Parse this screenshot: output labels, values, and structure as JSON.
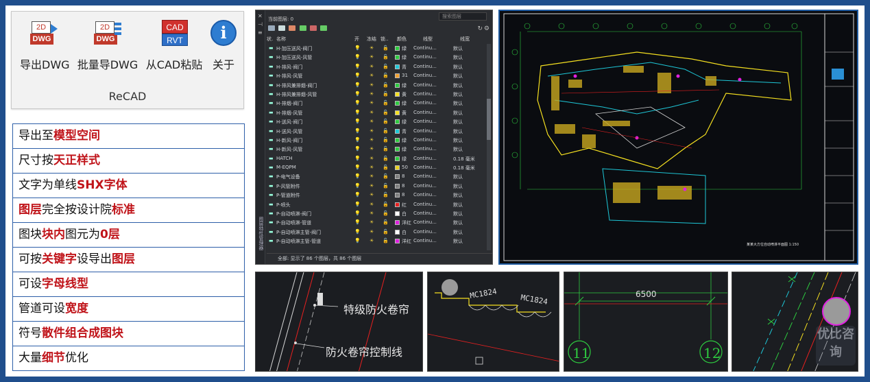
{
  "ribbon": {
    "buttons": [
      {
        "label": "导出DWG",
        "icon": "export-dwg-icon",
        "icon_text_top": "2D",
        "icon_text_bottom": "DWG"
      },
      {
        "label": "批量导DWG",
        "icon": "batch-export-dwg-icon",
        "icon_text_top": "2D",
        "icon_text_bottom": "DWG"
      },
      {
        "label": "从CAD粘贴",
        "icon": "paste-from-cad-icon",
        "icon_text_top": "CAD",
        "icon_text_bottom": "RVT"
      },
      {
        "label": "关于",
        "icon": "info-icon",
        "icon_text_top": "i"
      }
    ],
    "group_label": "ReCAD"
  },
  "features": [
    {
      "parts": [
        {
          "t": "导出至",
          "hl": false
        },
        {
          "t": "模型空间",
          "hl": true
        }
      ]
    },
    {
      "parts": [
        {
          "t": "尺寸按",
          "hl": false
        },
        {
          "t": "天正样式",
          "hl": true
        }
      ]
    },
    {
      "parts": [
        {
          "t": "文字为单线",
          "hl": false
        },
        {
          "t": "SHX字体",
          "hl": true
        }
      ]
    },
    {
      "parts": [
        {
          "t": "图层",
          "hl": true
        },
        {
          "t": "完全按设计院",
          "hl": false
        },
        {
          "t": "标准",
          "hl": true
        }
      ]
    },
    {
      "parts": [
        {
          "t": "图块",
          "hl": false
        },
        {
          "t": "块内",
          "hl": true
        },
        {
          "t": "图元为",
          "hl": false
        },
        {
          "t": "0层",
          "hl": true
        }
      ]
    },
    {
      "parts": [
        {
          "t": "可按",
          "hl": false
        },
        {
          "t": "关键字",
          "hl": true
        },
        {
          "t": "设导出",
          "hl": false
        },
        {
          "t": "图层",
          "hl": true
        }
      ]
    },
    {
      "parts": [
        {
          "t": "可设",
          "hl": false
        },
        {
          "t": "字母线型",
          "hl": true
        }
      ]
    },
    {
      "parts": [
        {
          "t": "管道可设",
          "hl": false
        },
        {
          "t": "宽度",
          "hl": true
        }
      ]
    },
    {
      "parts": [
        {
          "t": "符号",
          "hl": false
        },
        {
          "t": "散件组合成图块",
          "hl": true
        }
      ]
    },
    {
      "parts": [
        {
          "t": "大量",
          "hl": false
        },
        {
          "t": "细节",
          "hl": true
        },
        {
          "t": "优化",
          "hl": false
        }
      ]
    }
  ],
  "layer_manager": {
    "current_layer": "当前图层: 0",
    "search_placeholder": "搜索图层",
    "side_title": "图层特性管理器",
    "columns": [
      "状.",
      "名称",
      "开",
      "冻结",
      "锁..",
      "颜色",
      "线型",
      "线宽"
    ],
    "rows": [
      {
        "name": "H-加压送风-阀门",
        "color_name": "绿",
        "swatch": "#2ecc40",
        "linetype": "Continu...",
        "lineweight": "默认"
      },
      {
        "name": "H-加压送风-风管",
        "color_name": "绿",
        "swatch": "#2ecc40",
        "linetype": "Continu...",
        "lineweight": "默认"
      },
      {
        "name": "H-排风-阀门",
        "color_name": "青",
        "swatch": "#1ec8d8",
        "linetype": "Continu...",
        "lineweight": "默认"
      },
      {
        "name": "H-排风-风管",
        "color_name": "31",
        "swatch": "#f0a030",
        "linetype": "Continu...",
        "lineweight": "默认"
      },
      {
        "name": "H-排风兼排烟-阀门",
        "color_name": "绿",
        "swatch": "#2ecc40",
        "linetype": "Continu...",
        "lineweight": "默认"
      },
      {
        "name": "H-排风兼排烟-风管",
        "color_name": "黄",
        "swatch": "#f5e020",
        "linetype": "Continu...",
        "lineweight": "默认"
      },
      {
        "name": "H-排烟-阀门",
        "color_name": "绿",
        "swatch": "#2ecc40",
        "linetype": "Continu...",
        "lineweight": "默认"
      },
      {
        "name": "H-排烟-风管",
        "color_name": "黄",
        "swatch": "#f5e020",
        "linetype": "Continu...",
        "lineweight": "默认"
      },
      {
        "name": "H-送风-阀门",
        "color_name": "绿",
        "swatch": "#2ecc40",
        "linetype": "Continu...",
        "lineweight": "默认"
      },
      {
        "name": "H-送风-风管",
        "color_name": "青",
        "swatch": "#1ec8d8",
        "linetype": "Continu...",
        "lineweight": "默认"
      },
      {
        "name": "H-新风-阀门",
        "color_name": "绿",
        "swatch": "#2ecc40",
        "linetype": "Continu...",
        "lineweight": "默认"
      },
      {
        "name": "H-新风-风管",
        "color_name": "绿",
        "swatch": "#2ecc40",
        "linetype": "Continu...",
        "lineweight": "默认"
      },
      {
        "name": "HATCH",
        "color_name": "绿",
        "swatch": "#2ecc40",
        "linetype": "Continu...",
        "lineweight": "0.18 毫米"
      },
      {
        "name": "M-EQPM",
        "color_name": "50",
        "swatch": "#e8d020",
        "linetype": "Continu...",
        "lineweight": "0.18 毫米"
      },
      {
        "name": "P-电气设备",
        "color_name": "8",
        "swatch": "#7f7f7f",
        "linetype": "Continu...",
        "lineweight": "默认"
      },
      {
        "name": "P-风管附件",
        "color_name": "8",
        "swatch": "#7f7f7f",
        "linetype": "Continu...",
        "lineweight": "默认"
      },
      {
        "name": "P-管道附件",
        "color_name": "8",
        "swatch": "#7f7f7f",
        "linetype": "Continu...",
        "lineweight": "默认"
      },
      {
        "name": "P-喷头",
        "color_name": "红",
        "swatch": "#e82020",
        "linetype": "Continu...",
        "lineweight": "默认"
      },
      {
        "name": "P-自动喷淋-阀门",
        "color_name": "白",
        "swatch": "#ffffff",
        "linetype": "Continu...",
        "lineweight": "默认"
      },
      {
        "name": "P-自动喷淋-管道",
        "color_name": "洋红",
        "swatch": "#e020e0",
        "linetype": "Continu...",
        "lineweight": "默认"
      },
      {
        "name": "P-自动喷淋主管-阀门",
        "color_name": "白",
        "swatch": "#ffffff",
        "linetype": "Continu...",
        "lineweight": "默认"
      },
      {
        "name": "P-自动喷淋主管-管道",
        "color_name": "洋红",
        "swatch": "#e020e0",
        "linetype": "Continu...",
        "lineweight": "默认"
      }
    ],
    "status": "全部: 显示了 86 个图层，共 86 个图层"
  },
  "drawing": {
    "title_text": "某某大方位自动喷淋平面图  1:150"
  },
  "details": {
    "d1_labels": [
      "特级防火卷帘",
      "防火卷帘控制线"
    ],
    "d2_labels": [
      "MC1824",
      "MC1824"
    ],
    "d3_dimension": "6500",
    "d3_axes": [
      "11",
      "12"
    ]
  },
  "watermark": "优比咨询"
}
